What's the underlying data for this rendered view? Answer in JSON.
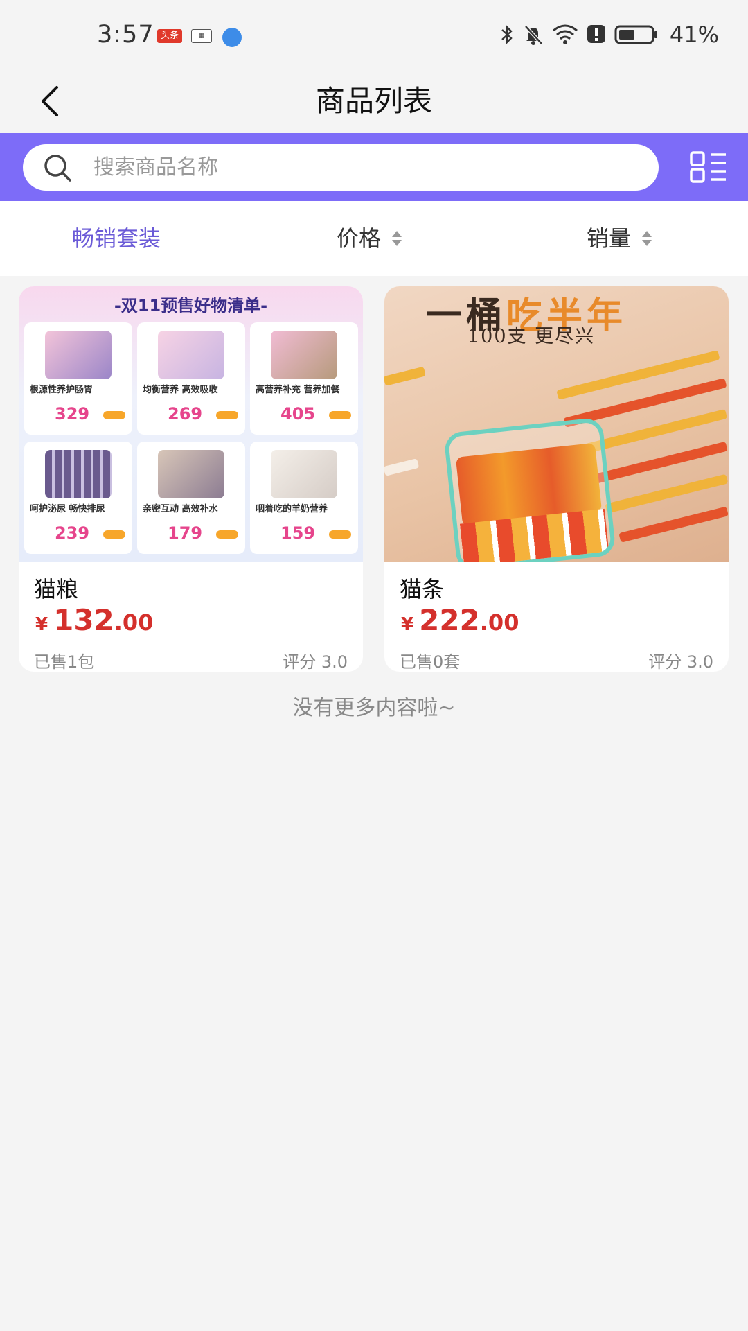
{
  "status_bar": {
    "time": "3:57",
    "toutiao_badge": "头条",
    "battery_pct": "41%",
    "icons": [
      "bluetooth-icon",
      "mute-icon",
      "wifi-icon",
      "alert-icon",
      "battery-icon"
    ]
  },
  "header": {
    "title": "商品列表"
  },
  "search": {
    "placeholder": "搜索商品名称"
  },
  "sort": {
    "items": [
      {
        "label": "畅销套装",
        "active": true
      },
      {
        "label": "价格"
      },
      {
        "label": "销量"
      }
    ]
  },
  "products": [
    {
      "name": "猫粮",
      "currency": "¥",
      "price_int": "132",
      "price_dec": ".00",
      "sold": "已售1包",
      "rating": "评分 3.0",
      "image": {
        "title": "-双11预售好物清单-",
        "tiles": [
          {
            "caption": "根源性养护肠胃",
            "price": "329"
          },
          {
            "caption": "均衡营养 高效吸收",
            "price": "269"
          },
          {
            "caption": "高营养补充 营养加餐",
            "price": "405"
          },
          {
            "caption": "呵护泌尿 畅快排尿",
            "price": "239"
          },
          {
            "caption": "亲密互动 高效补水",
            "price": "179"
          },
          {
            "caption": "咽着吃的羊奶营养",
            "price": "159"
          }
        ]
      }
    },
    {
      "name": "猫条",
      "currency": "¥",
      "price_int": "222",
      "price_dec": ".00",
      "sold": "已售0套",
      "rating": "评分 3.0",
      "image": {
        "headline_a": "一桶",
        "headline_b": "吃半年",
        "sub": "100支 更尽兴"
      }
    }
  ],
  "footer": {
    "no_more": "没有更多内容啦~"
  },
  "colors": {
    "accent": "#7d6cf8",
    "active_tab": "#6a5ad7",
    "price": "#d4302c"
  }
}
